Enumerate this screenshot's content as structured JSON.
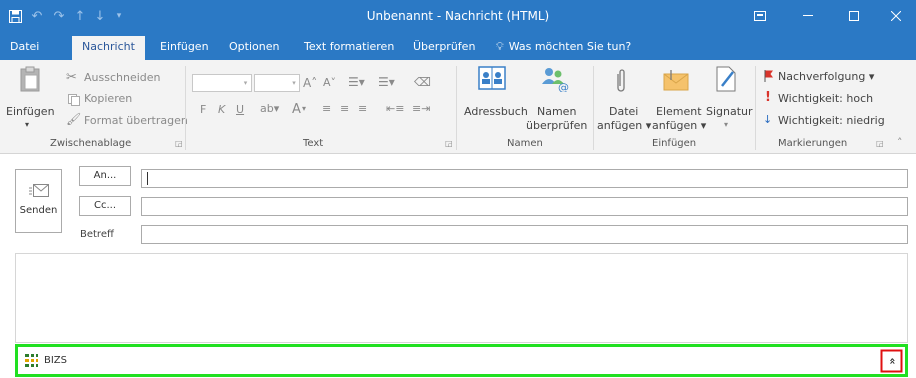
{
  "window": {
    "title": "Unbenannt - Nachricht (HTML)",
    "icons": [
      "save-icon",
      "undo-icon",
      "redo-icon",
      "up-arrow-icon",
      "down-arrow-icon",
      "customize-icon",
      "ribbon-display-icon",
      "minimize-icon",
      "maximize-icon",
      "close-icon"
    ]
  },
  "tabs": [
    "Datei",
    "Nachricht",
    "Einfügen",
    "Optionen",
    "Text formatieren",
    "Überprüfen"
  ],
  "active_tab": "Nachricht",
  "tellme": "Was möchten Sie tun?",
  "ribbon": {
    "clipboard": {
      "group": "Zwischenablage",
      "paste": "Einfügen",
      "cut": "Ausschneiden",
      "copy": "Kopieren",
      "format_painter": "Format übertragen"
    },
    "text": {
      "group": "Text",
      "bold": "F",
      "italic": "K",
      "underline": "U",
      "font_color": "A"
    },
    "names": {
      "group": "Namen",
      "addressbook": "Adressbuch",
      "check_names_1": "Namen",
      "check_names_2": "überprüfen"
    },
    "insert": {
      "group": "Einfügen",
      "attach_file_1": "Datei",
      "attach_file_2": "anfügen ▾",
      "attach_item_1": "Element",
      "attach_item_2": "anfügen ▾",
      "signature": "Signatur"
    },
    "tags": {
      "group": "Markierungen",
      "followup": "Nachverfolgung ▾",
      "importance_high": "Wichtigkeit: hoch",
      "importance_low": "Wichtigkeit: niedrig"
    }
  },
  "compose": {
    "send": "Senden",
    "to": "An...",
    "cc": "Cc...",
    "subject": "Betreff",
    "to_value": "",
    "cc_value": "",
    "subject_value": ""
  },
  "addin": {
    "name": "BIZS"
  },
  "colors": {
    "accent": "#2b79c5",
    "highlight_green": "#21e021",
    "highlight_red": "#e01010"
  }
}
